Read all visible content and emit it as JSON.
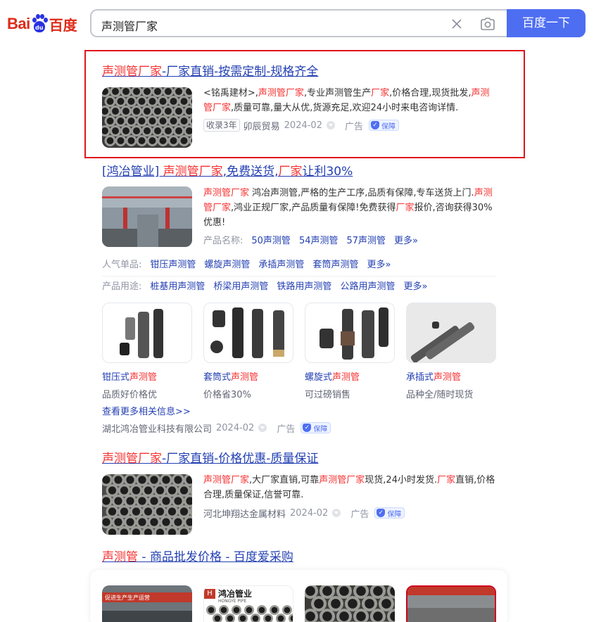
{
  "header": {
    "logo_bai": "Bai",
    "logo_du": "du",
    "logo_text": "百度",
    "query": "声测管厂家",
    "search_button": "百度一下"
  },
  "ad1": {
    "title_hl": "声测管厂家",
    "title_rest": "-厂家直销-按需定制-规格齐全",
    "desc": [
      {
        "t": "<铭禹建材>,"
      },
      {
        "t": "声测管厂家",
        "hl": true
      },
      {
        "t": ",专业声测管生产"
      },
      {
        "t": "厂家",
        "hl": true
      },
      {
        "t": ",价格合理,现货批发,"
      },
      {
        "t": "声测管厂家",
        "hl": true
      },
      {
        "t": ",质量可靠,量大从优,货源充足,欢迎24小时来电咨询详情."
      }
    ],
    "badge": "收录3年",
    "source": "卯辰贸易",
    "date": "2024-02",
    "ad_label": "广告",
    "guarantee": "保障"
  },
  "ad2": {
    "title_a": "[鸿冶管业] ",
    "title_b": "声测管厂家",
    "title_c": ",免费送货,",
    "title_d": "厂家",
    "title_e": "让利30%",
    "desc": [
      {
        "t": "声测管厂家",
        "hl": true
      },
      {
        "t": " 鸿冶声测管,严格的生产工序,品质有保障,专车送货上门."
      },
      {
        "t": "声测管厂家",
        "hl": true
      },
      {
        "t": ",鸿业正规厂家,产品质量有保障!免费获得"
      },
      {
        "t": "厂家",
        "hl": true
      },
      {
        "t": "报价,咨询获得30%优惠!"
      }
    ],
    "product_label": "产品名称:",
    "products": [
      "50声测管",
      "54声测管",
      "57声测管",
      "更多»"
    ],
    "popular_label": "人气单品:",
    "popular": [
      "钳压声测管",
      "螺旋声测管",
      "承插声测管",
      "套筒声测管",
      "更多»"
    ],
    "usage_label": "产品用途:",
    "usage": [
      "桩基用声测管",
      "桥梁用声测管",
      "铁路用声测管",
      "公路用声测管",
      "更多»"
    ],
    "cards": [
      {
        "title_a": "钳压式",
        "title_b": "声测管",
        "sub": "品质好价格优"
      },
      {
        "title_a": "套筒式",
        "title_b": "声测管",
        "sub": "价格省30%"
      },
      {
        "title_a": "螺旋式",
        "title_b": "声测管",
        "sub": "可过磅销售"
      },
      {
        "title_a": "承插式",
        "title_b": "声测管",
        "sub": "品种全/随时现货"
      }
    ],
    "more_info": "查看更多相关信息>>",
    "source": "湖北鸿冶管业科技有限公司",
    "date": "2024-02",
    "ad_label": "广告",
    "guarantee": "保障"
  },
  "ad3": {
    "title_hl": "声测管厂家",
    "title_rest": "-厂家直销-价格优惠-质量保证",
    "desc": [
      {
        "t": "声测管厂家",
        "hl": true
      },
      {
        "t": ",大厂家直销,可靠"
      },
      {
        "t": "声测管厂家",
        "hl": true
      },
      {
        "t": "现货,24小时发货."
      },
      {
        "t": "厂家",
        "hl": true
      },
      {
        "t": "直销,价格合理,质量保证,信誉可靠."
      }
    ],
    "source": "河北坤翔达金属材料",
    "date": "2024-02",
    "ad_label": "广告",
    "guarantee": "保障"
  },
  "result4": {
    "title_hl": "声测管",
    "title_rest": " - 商品批发价格 - 百度爱采购",
    "shop_logo_text": "鸿冶管业",
    "shop_logo_sub": "HONGYE PIPE",
    "banner_text": "促进生产生产运营"
  }
}
